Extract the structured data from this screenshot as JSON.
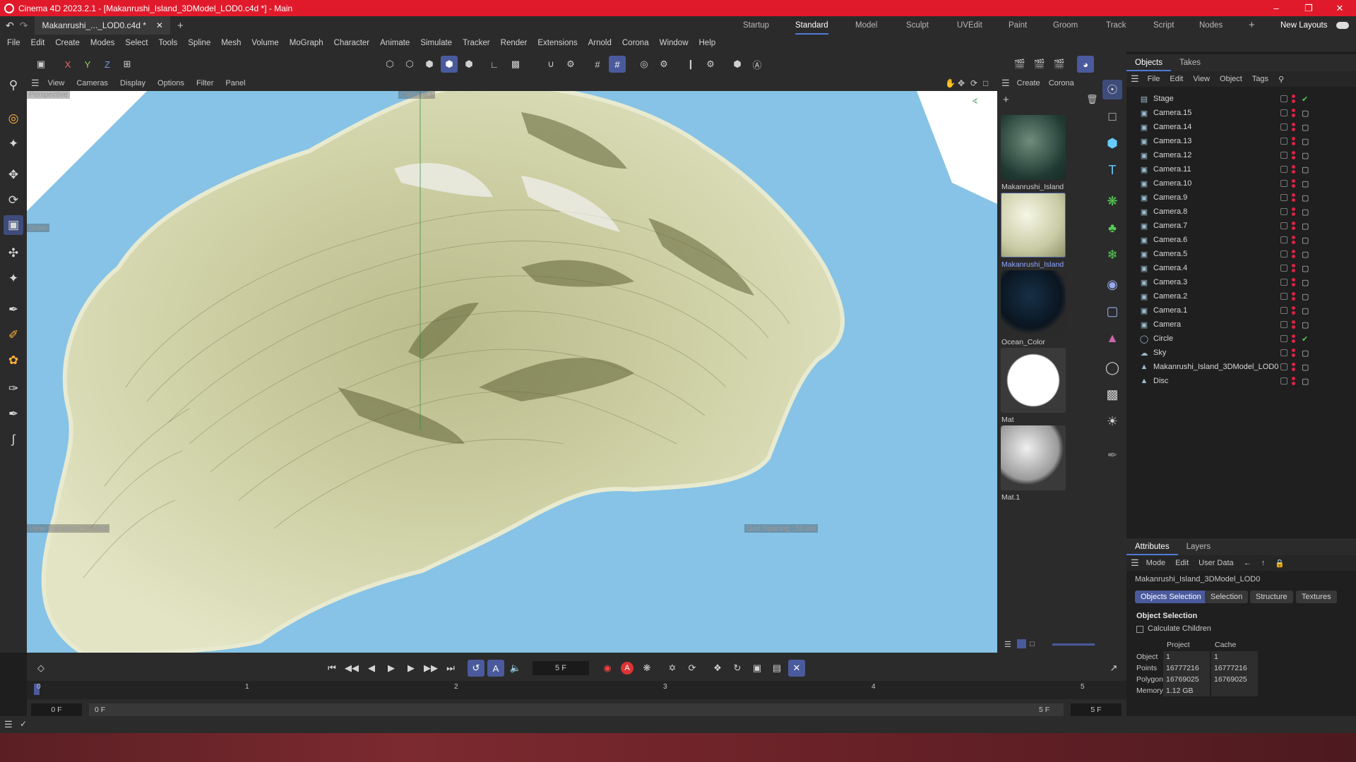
{
  "window": {
    "title": "Cinema 4D 2023.2.1 - [Makanrushi_Island_3DModel_LOD0.c4d *] - Main"
  },
  "doc_tab": {
    "label": "Makanrushi_..._LOD0.c4d *"
  },
  "layouts": [
    "Startup",
    "Standard",
    "Model",
    "Sculpt",
    "UVEdit",
    "Paint",
    "Groom",
    "Track",
    "Script",
    "Nodes"
  ],
  "new_layouts": "New Layouts",
  "menu": [
    "File",
    "Edit",
    "Create",
    "Modes",
    "Select",
    "Tools",
    "Spline",
    "Mesh",
    "Volume",
    "MoGraph",
    "Character",
    "Animate",
    "Simulate",
    "Tracker",
    "Render",
    "Extensions",
    "Arnold",
    "Corona",
    "Window",
    "Help"
  ],
  "axis_buttons": [
    "X",
    "Y",
    "Z"
  ],
  "viewport": {
    "menu": [
      "View",
      "Cameras",
      "Display",
      "Options",
      "Filter",
      "Panel"
    ],
    "name": "Perspective",
    "camera": "Camera.1",
    "scale_label": "Scale",
    "view_transform": "View Transform: Project",
    "grid_spacing": "Grid Spacing : 50 cm"
  },
  "materials": {
    "menu": [
      "Create",
      "Corona"
    ],
    "items": [
      "Makanrushi_Island",
      "Makanrushi_Island",
      "Ocean_Color",
      "Mat",
      "Mat.1"
    ]
  },
  "objects_panel": {
    "tabs": [
      "Objects",
      "Takes"
    ],
    "menu": [
      "File",
      "Edit",
      "View",
      "Object",
      "Tags"
    ],
    "items": [
      "Stage",
      "Camera.15",
      "Camera.14",
      "Camera.13",
      "Camera.12",
      "Camera.11",
      "Camera.10",
      "Camera.9",
      "Camera.8",
      "Camera.7",
      "Camera.6",
      "Camera.5",
      "Camera.4",
      "Camera.3",
      "Camera.2",
      "Camera.1",
      "Camera",
      "Circle",
      "Sky",
      "Makanrushi_Island_3DModel_LOD0",
      "Disc"
    ]
  },
  "attributes": {
    "tabs": [
      "Attributes",
      "Layers"
    ],
    "menu": [
      "Mode",
      "Edit",
      "User Data"
    ],
    "object_name": "Makanrushi_Island_3DModel_LOD0",
    "buttons": [
      "Objects Selection",
      "Selection",
      "Structure",
      "Textures"
    ],
    "section": "Object Selection",
    "calc_children": "Calculate Children",
    "col_project": "Project",
    "col_cache": "Cache",
    "rows": [
      {
        "label": "Object",
        "project": "1",
        "cache": "1"
      },
      {
        "label": "Points",
        "project": "16777216",
        "cache": "16777216"
      },
      {
        "label": "Polygons",
        "project": "16769025",
        "cache": "16769025"
      },
      {
        "label": "Memory",
        "project": "1.12 GB",
        "cache": ""
      }
    ]
  },
  "timeline": {
    "current_frame": "5 F",
    "ruler": [
      "0",
      "1",
      "2",
      "3",
      "4",
      "5"
    ],
    "start": "0 F",
    "range_start": "0 F",
    "range_end": "5 F",
    "end": "5 F"
  },
  "colors": {
    "titlebar": "#e01a2b",
    "accent": "#4a5a9c",
    "ocean": "#7fbde0",
    "land": "#d9dcb8"
  }
}
